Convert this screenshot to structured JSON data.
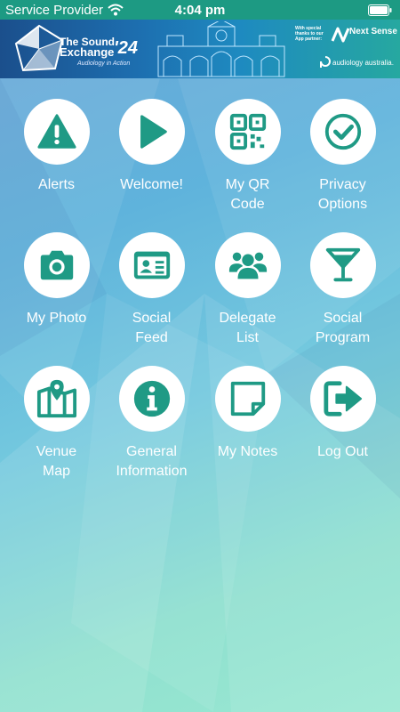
{
  "status_bar": {
    "carrier": "Service Provider",
    "time": "4:04 pm"
  },
  "banner": {
    "title_line1": "The Sound",
    "title_line2": "Exchange",
    "year": "'24",
    "tagline": "Audiology in Action",
    "sponsor_note": "With special thanks to our App partner:",
    "partner": "Next Sense",
    "partner2": "audiology australia."
  },
  "theme": {
    "accent": "#1d9a83",
    "icon_color": "#1f9a85",
    "tile_bg": "#ffffff"
  },
  "tiles": [
    {
      "label": "Alerts",
      "icon": "warning-icon"
    },
    {
      "label": "Welcome!",
      "icon": "play-icon"
    },
    {
      "label": "My QR\nCode",
      "icon": "qr-code-icon"
    },
    {
      "label": "Privacy\nOptions",
      "icon": "check-circle-icon"
    },
    {
      "label": "My Photo",
      "icon": "camera-icon"
    },
    {
      "label": "Social\nFeed",
      "icon": "id-card-icon"
    },
    {
      "label": "Delegate\nList",
      "icon": "users-icon"
    },
    {
      "label": "Social\nProgram",
      "icon": "cocktail-icon"
    },
    {
      "label": "Venue\nMap",
      "icon": "map-icon"
    },
    {
      "label": "General\nInformation",
      "icon": "info-icon"
    },
    {
      "label": "My Notes",
      "icon": "sticky-note-icon"
    },
    {
      "label": "Log Out",
      "icon": "logout-icon"
    }
  ]
}
